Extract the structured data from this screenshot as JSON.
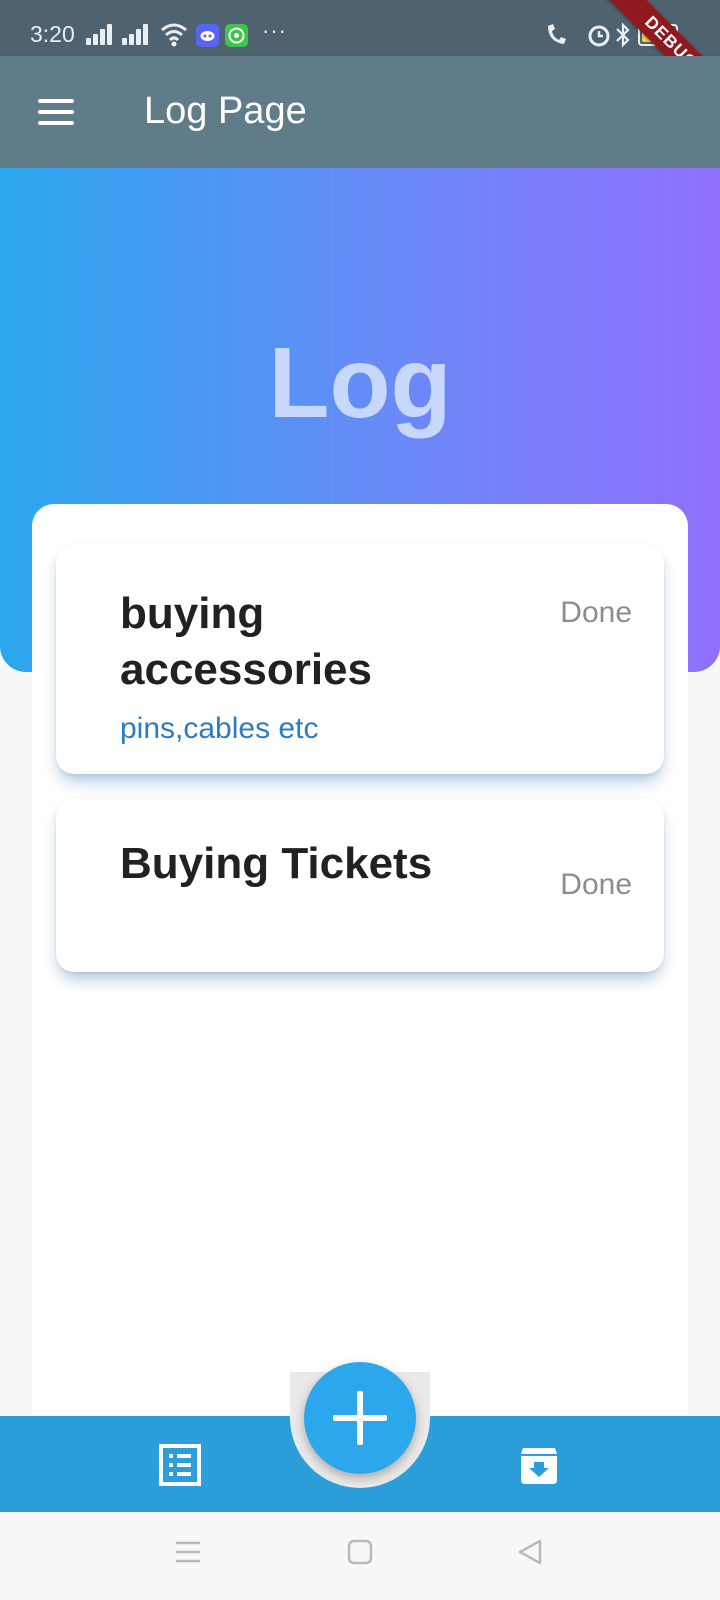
{
  "status_bar": {
    "time": "3:20",
    "more": "···",
    "battery": "100",
    "discord_color": "#5865f2",
    "whatsapp_color": "#3ac84b"
  },
  "debug_banner": {
    "label": "DEBUG"
  },
  "app_bar": {
    "title": "Log Page",
    "background": "#617c89"
  },
  "hero": {
    "title": "Log",
    "gradient": [
      "#2aa7ee",
      "#8f6ffd"
    ]
  },
  "log_items": [
    {
      "title": "buying accessories",
      "subtitle": "pins,cables etc",
      "status": "Done"
    },
    {
      "title": "Buying Tickets",
      "subtitle": "",
      "status": "Done"
    }
  ],
  "bottom_nav": {
    "background": "#2c9ed9",
    "left_icon": "list-icon",
    "fab_icon": "plus-icon",
    "right_icon": "archive-icon"
  },
  "system_nav": {
    "icons": [
      "recents-icon",
      "home-icon",
      "back-icon"
    ]
  }
}
